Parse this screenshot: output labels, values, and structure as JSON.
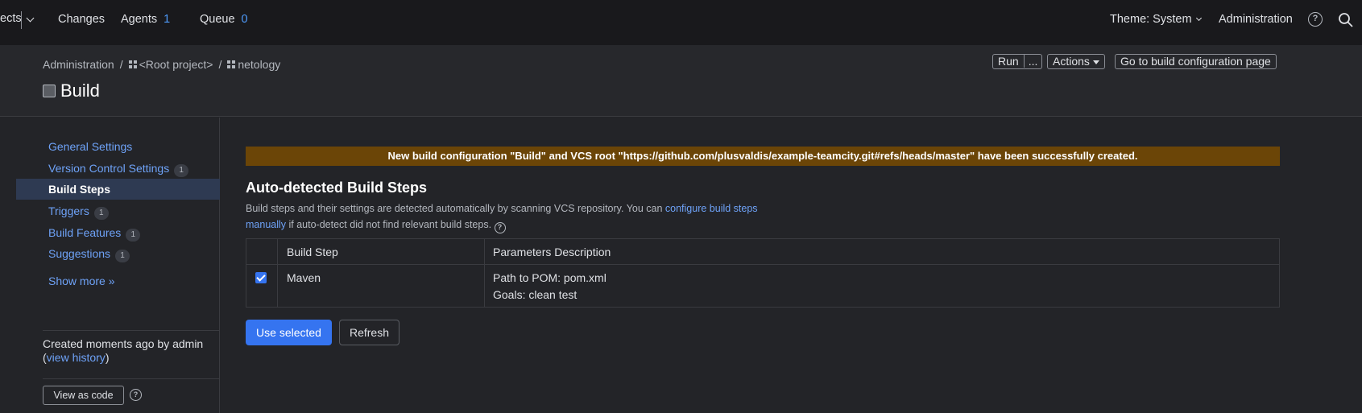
{
  "topbar": {
    "projects_partial": "ects",
    "changes": "Changes",
    "agents": "Agents",
    "agents_count": "1",
    "queue": "Queue",
    "queue_count": "0",
    "theme": "Theme: System",
    "administration": "Administration",
    "help_glyph": "?"
  },
  "breadcrumb": {
    "admin": "Administration",
    "sep": "/",
    "root": "<Root project>",
    "project": "netology"
  },
  "page": {
    "title": "Build",
    "run": "Run",
    "more": "...",
    "actions": "Actions",
    "goto": "Go to build configuration page"
  },
  "sidebar": {
    "items": [
      {
        "label": "General Settings",
        "badge": ""
      },
      {
        "label": "Version Control Settings",
        "badge": "1"
      },
      {
        "label": "Build Steps",
        "badge": ""
      },
      {
        "label": "Triggers",
        "badge": "1"
      },
      {
        "label": "Build Features",
        "badge": "1"
      },
      {
        "label": "Suggestions",
        "badge": "1"
      }
    ],
    "show_more": "Show more »",
    "created_text": "Created moments ago by admin",
    "created_open": "(",
    "view_history": "view history",
    "created_close": ")",
    "view_as_code": "View as code"
  },
  "main": {
    "banner": "New build configuration \"Build\" and VCS root \"https://github.com/plusvaldis/example-teamcity.git#refs/heads/master\" have been successfully created.",
    "heading": "Auto-detected Build Steps",
    "desc_before": "Build steps and their settings are detected automatically by scanning VCS repository. You can ",
    "desc_link": "configure build steps manually",
    "desc_after": " if auto-detect did not find relevant build steps.",
    "table": {
      "col_step": "Build Step",
      "col_params": "Parameters Description",
      "rows": [
        {
          "step": "Maven",
          "param1": "Path to POM: pom.xml",
          "param2": "Goals: clean test",
          "checked": true
        }
      ]
    },
    "use_selected": "Use selected",
    "refresh": "Refresh"
  },
  "colors": {
    "accent": "#3574f0",
    "link": "#6ea2f7",
    "banner": "#6b4507",
    "background": "#232428"
  }
}
